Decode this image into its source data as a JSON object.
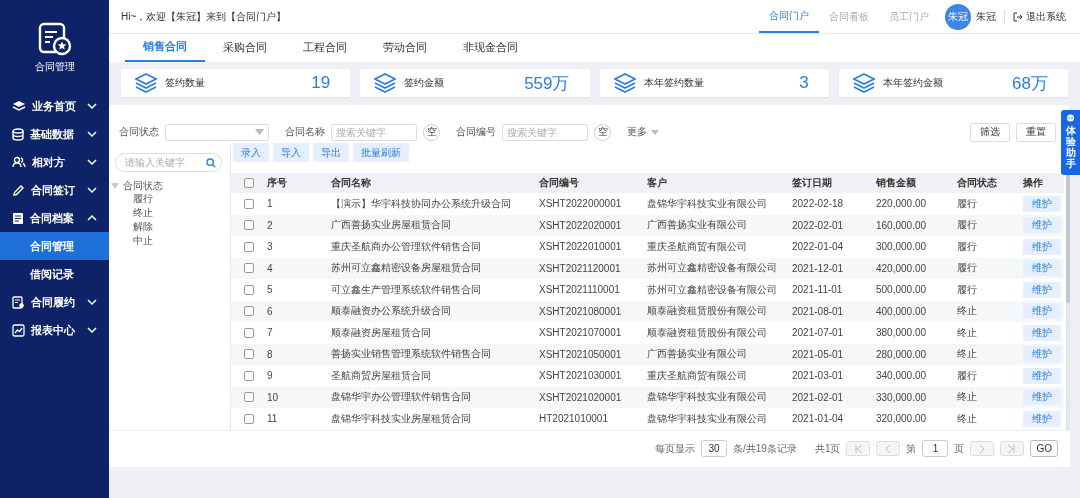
{
  "header": {
    "greeting": "Hi~，欢迎【朱冠】来到【合同门户】",
    "nav": [
      {
        "label": "合同门户",
        "selected": true
      },
      {
        "label": "合同看板",
        "selected": false
      },
      {
        "label": "员工门户",
        "selected": false
      }
    ],
    "avatar": "朱冠",
    "user": "朱冠",
    "logout": "退出系统"
  },
  "sidebar": {
    "title": "合同管理",
    "items": [
      {
        "label": "业务首页",
        "expanded": false
      },
      {
        "label": "基础数据",
        "expanded": false
      },
      {
        "label": "相对方",
        "expanded": false
      },
      {
        "label": "合同签订",
        "expanded": false
      },
      {
        "label": "合同档案",
        "expanded": true,
        "children": [
          {
            "label": "合同管理",
            "selected": true
          },
          {
            "label": "借阅记录",
            "selected": false
          }
        ]
      },
      {
        "label": "合同履约",
        "expanded": false
      },
      {
        "label": "报表中心",
        "expanded": false
      }
    ]
  },
  "tabs": [
    {
      "label": "销售合同",
      "selected": true
    },
    {
      "label": "采购合同",
      "selected": false
    },
    {
      "label": "工程合同",
      "selected": false
    },
    {
      "label": "劳动合同",
      "selected": false
    },
    {
      "label": "非现金合同",
      "selected": false
    }
  ],
  "stats": [
    {
      "label": "签约数量",
      "value": "19"
    },
    {
      "label": "签约金额",
      "value": "559万"
    },
    {
      "label": "本年签约数量",
      "value": "3"
    },
    {
      "label": "本年签约金额",
      "value": "68万"
    }
  ],
  "filters": [
    {
      "kind": "select",
      "label": "合同状态"
    },
    {
      "kind": "search",
      "label": "合同名称",
      "placeholder": "搜索关键字",
      "clear": "空"
    },
    {
      "kind": "search",
      "label": "合同编号",
      "placeholder": "搜索关键字",
      "clear": "空"
    }
  ],
  "more": "更多",
  "filter_buttons": [
    "筛选",
    "重置"
  ],
  "assistant": "体验助手",
  "tree": {
    "placeholder": "请输入关键字",
    "root": {
      "label": "合同状态",
      "expanded": true,
      "children": [
        {
          "label": "履行"
        },
        {
          "label": "终止"
        },
        {
          "label": "解除"
        },
        {
          "label": "中止"
        }
      ]
    }
  },
  "toolbar": [
    "录入",
    "导入",
    "导出",
    "批量刷新"
  ],
  "table": {
    "all_checked": false,
    "columns": [
      "序号",
      "合同名称",
      "合同编号",
      "客户",
      "签订日期",
      "销售金额",
      "合同状态",
      "操作"
    ],
    "rows": [
      {
        "checked": false,
        "cells": [
          "1",
          "【演示】华宇科技协同办公系统升级合同",
          "XSHT2022000001",
          "盘锦华宇科技实业有限公司",
          "2022-02-18",
          "220,000.00",
          "履行"
        ],
        "action": "维护"
      },
      {
        "checked": false,
        "cells": [
          "2",
          "广西善扬实业房屋租赁合同",
          "XSHT2022020001",
          "广西善扬实业有限公司",
          "2022-02-01",
          "160,000.00",
          "履行"
        ],
        "action": "维护"
      },
      {
        "checked": false,
        "cells": [
          "3",
          "重庆圣航商办公管理软件销售合同",
          "XSHT2022010001",
          "重庆圣航商贸有限公司",
          "2022-01-04",
          "300,000.00",
          "履行"
        ],
        "action": "维护"
      },
      {
        "checked": false,
        "cells": [
          "4",
          "苏州可立鑫精密设备房屋租赁合同",
          "XSHT2021120001",
          "苏州可立鑫精密设备有限公司",
          "2021-12-01",
          "420,000.00",
          "履行"
        ],
        "action": "维护"
      },
      {
        "checked": false,
        "cells": [
          "5",
          "可立鑫生产管理系统软件销售合同",
          "XSHT2021110001",
          "苏州可立鑫精密设备有限公司",
          "2021-11-01",
          "500,000.00",
          "履行"
        ],
        "action": "维护"
      },
      {
        "checked": false,
        "cells": [
          "6",
          "顺泰融资办公系统升级合同",
          "XSHT2021080001",
          "顺泰融资租赁股份有限公司",
          "2021-08-01",
          "400,000.00",
          "终止"
        ],
        "action": "维护"
      },
      {
        "checked": false,
        "cells": [
          "7",
          "顺泰融资房屋租赁合同",
          "XSHT2021070001",
          "顺泰融资租赁股份有限公司",
          "2021-07-01",
          "380,000.00",
          "终止"
        ],
        "action": "维护"
      },
      {
        "checked": false,
        "cells": [
          "8",
          "善扬实业销售管理系统软件销售合同",
          "XSHT2021050001",
          "广西善扬实业有限公司",
          "2021-05-01",
          "280,000.00",
          "终止"
        ],
        "action": "维护"
      },
      {
        "checked": false,
        "cells": [
          "9",
          "圣航商贸房屋租赁合同",
          "XSHT2021030001",
          "重庆圣航商贸有限公司",
          "2021-03-01",
          "340,000.00",
          "履行"
        ],
        "action": "维护"
      },
      {
        "checked": false,
        "cells": [
          "10",
          "盘锦华宇办公管理软件销售合同",
          "XSHT2021020001",
          "盘锦华宇科技实业有限公司",
          "2021-02-01",
          "330,000.00",
          "终止"
        ],
        "action": "维护"
      },
      {
        "checked": false,
        "cells": [
          "11",
          "盘锦华宇科技实业房屋租赁合同",
          "HT2021010001",
          "盘锦华宇科技实业有限公司",
          "2021-01-04",
          "320,000.00",
          "终止"
        ],
        "action": "维护"
      }
    ]
  },
  "pager": {
    "per_page_label": "每页显示",
    "per_page": "30",
    "total": "条/共19条记录",
    "pages": "共1页",
    "nav": [
      {
        "disabled": true
      },
      {
        "disabled": true
      },
      {
        "disabled": true
      },
      {
        "disabled": true
      }
    ],
    "page_prefix": "第",
    "page": "1",
    "page_suffix": "页",
    "go": "GO"
  }
}
